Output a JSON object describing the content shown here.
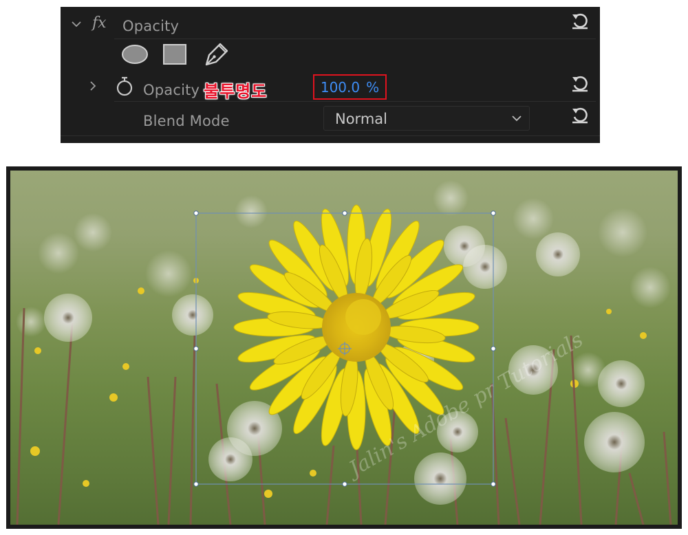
{
  "effect": {
    "title": "Opacity",
    "fx_label": "fx",
    "mask_tools": [
      "ellipse-mask-icon",
      "rectangle-mask-icon",
      "pen-mask-icon"
    ],
    "opacity": {
      "label": "Opacity",
      "annotation": "불투명도",
      "value": "100.0",
      "unit": "%"
    },
    "blend_mode": {
      "label": "Blend Mode",
      "value": "Normal"
    }
  },
  "preview": {
    "watermark": "Jalin's Adobe pr Tutorials"
  },
  "colors": {
    "panel_bg": "#1d1d1d",
    "value_blue": "#3e8df5",
    "highlight_red": "#e1131f",
    "flower_yellow": "#f2df12"
  }
}
